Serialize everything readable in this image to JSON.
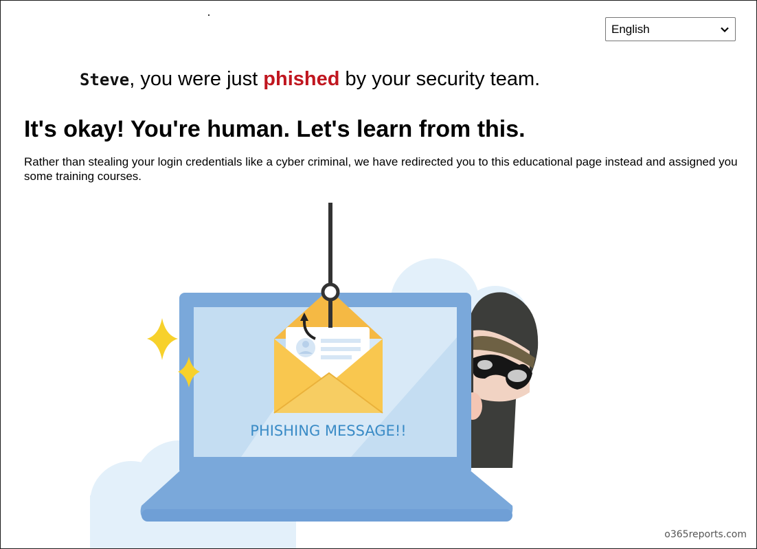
{
  "language_selector": {
    "selected": "English"
  },
  "headline": {
    "user": "Steve",
    "prefix": ", you were just ",
    "highlight": "phished",
    "suffix": " by your security team."
  },
  "title": "It's okay! You're human. Let's learn from this.",
  "description": "Rather than stealing your login credentials like a cyber criminal, we have redirected you to this educational page instead and assigned you some training courses.",
  "illustration": {
    "caption": "PHISHING MESSAGE!!"
  },
  "watermark": "o365reports.com",
  "colors": {
    "phished": "#c0161f",
    "laptop": "#7aa8da",
    "envelope": "#f9c74f",
    "caption": "#3a8bc6"
  }
}
